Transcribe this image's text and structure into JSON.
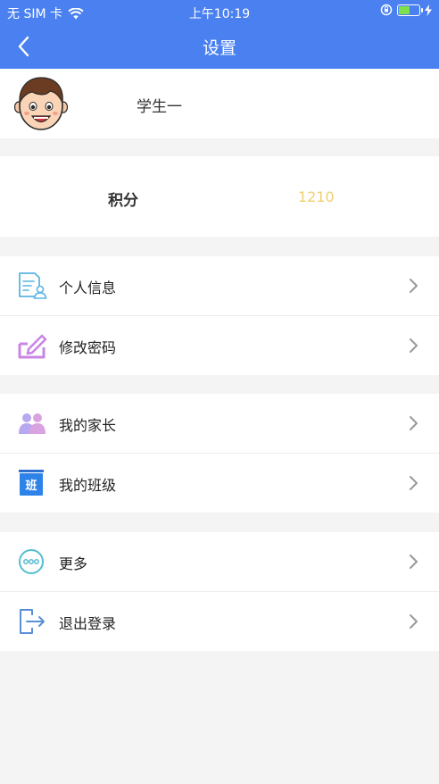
{
  "status_bar": {
    "carrier": "无 SIM 卡",
    "time": "上午10:19",
    "battery_level": 0.55
  },
  "nav": {
    "title": "设置"
  },
  "profile": {
    "name": "学生一"
  },
  "points": {
    "label": "积分",
    "value": "1210"
  },
  "menu": [
    {
      "label": "个人信息",
      "icon": "personal-info-icon"
    },
    {
      "label": "修改密码",
      "icon": "edit-password-icon"
    },
    {
      "label": "我的家长",
      "icon": "parents-icon"
    },
    {
      "label": "我的班级",
      "icon": "class-icon",
      "icon_text": "班"
    },
    {
      "label": "更多",
      "icon": "more-icon"
    },
    {
      "label": "退出登录",
      "icon": "logout-icon"
    }
  ],
  "colors": {
    "header_bg": "#4a80f0",
    "points_value": "#f0cf6e",
    "background": "#f4f4f4"
  }
}
